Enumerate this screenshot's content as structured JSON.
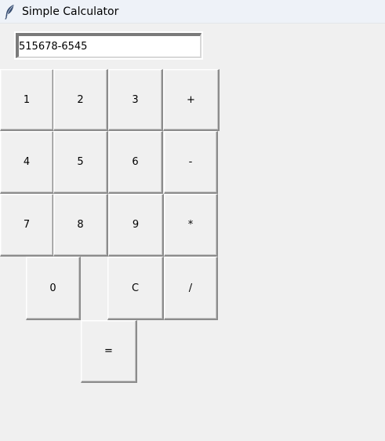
{
  "window": {
    "title": "Simple Calculator",
    "icon": "feather-icon"
  },
  "display": {
    "value": "515678-6545"
  },
  "buttons": {
    "one": "1",
    "two": "2",
    "three": "3",
    "plus": "+",
    "four": "4",
    "five": "5",
    "six": "6",
    "minus": "-",
    "seven": "7",
    "eight": "8",
    "nine": "9",
    "multiply": "*",
    "zero": "0",
    "clear": "C",
    "divide": "/",
    "equals": "="
  }
}
